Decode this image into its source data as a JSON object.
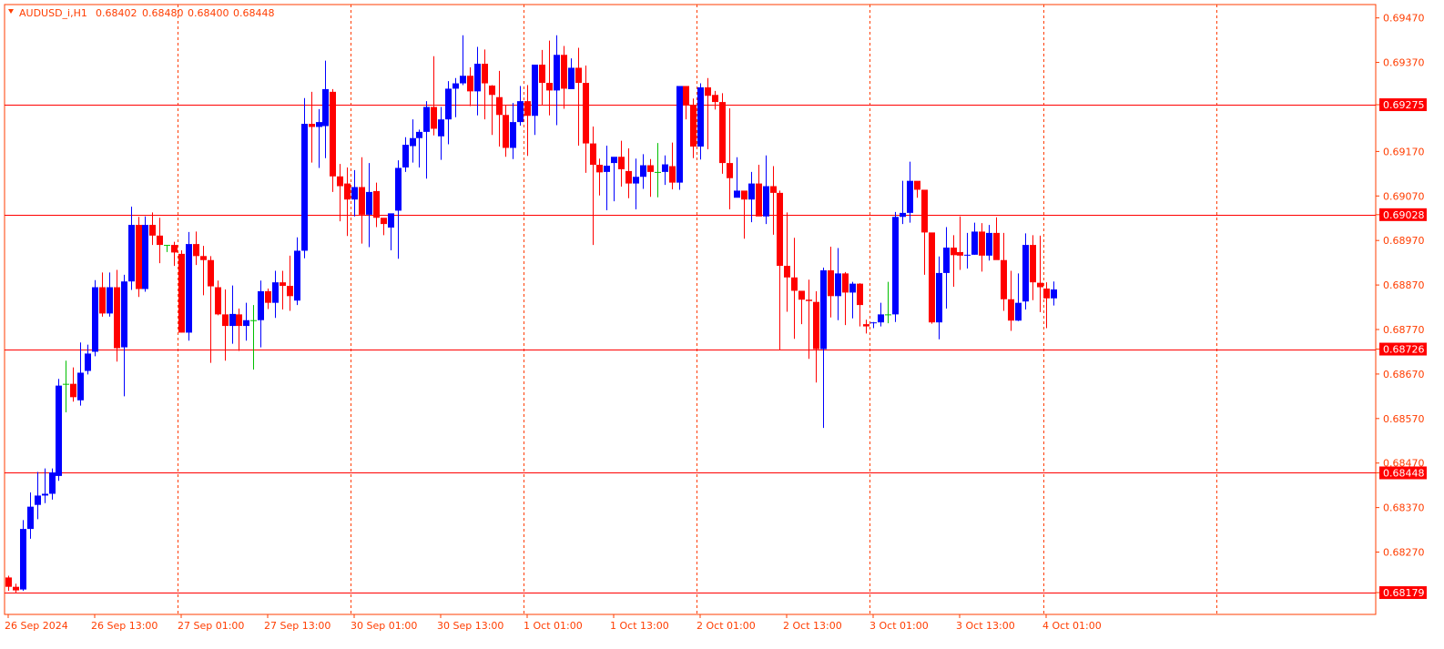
{
  "chart_data": {
    "type": "candlestick",
    "symbol_line": {
      "symbol": "AUDUSD_i,H1",
      "open": "0.68402",
      "high": "0.68480",
      "low": "0.68400",
      "close": "0.68448"
    },
    "y_range": [
      0.6813,
      0.695
    ],
    "price_ticks": [
      "0.69470",
      "0.69370",
      "0.69275",
      "0.69170",
      "0.69070",
      "0.69028",
      "0.68970",
      "0.68870",
      "0.68770",
      "0.68726",
      "0.68670",
      "0.68570",
      "0.68470",
      "0.68448",
      "0.68370",
      "0.68270",
      "0.68179"
    ],
    "levels": [
      0.69275,
      0.69028,
      0.68726,
      0.68448,
      0.68179
    ],
    "level_labels": [
      "0.69275",
      "0.69028",
      "0.68726",
      "0.68448",
      "0.68179"
    ],
    "time_labels": [
      "26 Sep 2024",
      "26 Sep 13:00",
      "27 Sep 01:00",
      "27 Sep 13:00",
      "30 Sep 01:00",
      "30 Sep 13:00",
      "1 Oct 01:00",
      "1 Oct 13:00",
      "2 Oct 01:00",
      "2 Oct 13:00",
      "3 Oct 01:00",
      "3 Oct 13:00",
      "4 Oct 01:00"
    ],
    "time_label_bars": [
      0,
      12,
      24,
      36,
      48,
      60,
      72,
      84,
      96,
      108,
      120,
      132,
      144
    ],
    "separator_bars": [
      23,
      47,
      71,
      95,
      119,
      143,
      167
    ],
    "total_bars": 190,
    "colors": {
      "up": "#0000ff",
      "down": "#ff0000",
      "axis": "#ff3d00",
      "level": "#ff0000",
      "separator": "#ff3d00",
      "doji": "#00c000"
    },
    "candles": [
      [
        0.68213,
        0.68217,
        0.68183,
        0.68192
      ],
      [
        0.68192,
        0.68199,
        0.68178,
        0.68184
      ],
      [
        0.68186,
        0.68342,
        0.68183,
        0.68322
      ],
      [
        0.68322,
        0.68404,
        0.683,
        0.68372
      ],
      [
        0.68376,
        0.6845,
        0.68344,
        0.68397
      ],
      [
        0.68397,
        0.68458,
        0.6838,
        0.68401
      ],
      [
        0.68401,
        0.68458,
        0.68388,
        0.68449
      ],
      [
        0.68441,
        0.68659,
        0.6843,
        0.68644
      ],
      [
        0.68648,
        0.687,
        0.68584,
        0.68648
      ],
      [
        0.68648,
        0.68685,
        0.68608,
        0.68618
      ],
      [
        0.68611,
        0.68741,
        0.68599,
        0.68673
      ],
      [
        0.68677,
        0.68736,
        0.68669,
        0.68716
      ],
      [
        0.6872,
        0.68881,
        0.6871,
        0.68865
      ],
      [
        0.68865,
        0.68898,
        0.68799,
        0.68806
      ],
      [
        0.68806,
        0.68898,
        0.68799,
        0.68865
      ],
      [
        0.68865,
        0.68904,
        0.68698,
        0.68728
      ],
      [
        0.6873,
        0.68893,
        0.6862,
        0.68878
      ],
      [
        0.68878,
        0.69046,
        0.68859,
        0.69005
      ],
      [
        0.69005,
        0.69023,
        0.68843,
        0.68861
      ],
      [
        0.68861,
        0.69024,
        0.68855,
        0.69005
      ],
      [
        0.69005,
        0.69033,
        0.6896,
        0.68981
      ],
      [
        0.68981,
        0.69021,
        0.68919,
        0.6896
      ],
      [
        0.6896,
        0.6896,
        0.68944,
        0.6896
      ],
      [
        0.6896,
        0.68967,
        0.68913,
        0.68943
      ],
      [
        0.6894,
        0.68948,
        0.68763,
        0.68763
      ],
      [
        0.68763,
        0.68989,
        0.68745,
        0.68962
      ],
      [
        0.68962,
        0.6899,
        0.68915,
        0.68935
      ],
      [
        0.68935,
        0.68958,
        0.68847,
        0.68926
      ],
      [
        0.68926,
        0.68935,
        0.68695,
        0.68867
      ],
      [
        0.68865,
        0.6888,
        0.68802,
        0.68804
      ],
      [
        0.68804,
        0.6886,
        0.687,
        0.68778
      ],
      [
        0.68778,
        0.68869,
        0.68738,
        0.68805
      ],
      [
        0.68804,
        0.68817,
        0.68722,
        0.68778
      ],
      [
        0.68778,
        0.6883,
        0.68745,
        0.68791
      ],
      [
        0.68791,
        0.68825,
        0.6868,
        0.68791
      ],
      [
        0.68791,
        0.6888,
        0.6873,
        0.68856
      ],
      [
        0.68856,
        0.68862,
        0.68816,
        0.6883
      ],
      [
        0.6883,
        0.68902,
        0.68796,
        0.68876
      ],
      [
        0.68876,
        0.68902,
        0.68815,
        0.68868
      ],
      [
        0.68868,
        0.68936,
        0.68812,
        0.68845
      ],
      [
        0.68835,
        0.68977,
        0.68825,
        0.68947
      ],
      [
        0.68947,
        0.6929,
        0.6893,
        0.69232
      ],
      [
        0.69232,
        0.69304,
        0.69145,
        0.69225
      ],
      [
        0.69225,
        0.69265,
        0.69133,
        0.69236
      ],
      [
        0.69227,
        0.69374,
        0.69155,
        0.6931
      ],
      [
        0.69304,
        0.6931,
        0.69079,
        0.69114
      ],
      [
        0.69114,
        0.69142,
        0.69013,
        0.69092
      ],
      [
        0.69098,
        0.69134,
        0.6898,
        0.69062
      ],
      [
        0.69062,
        0.69128,
        0.69024,
        0.6909
      ],
      [
        0.6909,
        0.69157,
        0.68963,
        0.69028
      ],
      [
        0.69028,
        0.69144,
        0.68955,
        0.69079
      ],
      [
        0.69081,
        0.691,
        0.69,
        0.69021
      ],
      [
        0.69021,
        0.69017,
        0.68982,
        0.69007
      ],
      [
        0.68999,
        0.6903,
        0.68948,
        0.69031
      ],
      [
        0.69037,
        0.6915,
        0.68929,
        0.69133
      ],
      [
        0.69134,
        0.69202,
        0.69124,
        0.69185
      ],
      [
        0.69182,
        0.69242,
        0.69145,
        0.692
      ],
      [
        0.692,
        0.69219,
        0.69134,
        0.69214
      ],
      [
        0.69214,
        0.69283,
        0.69109,
        0.6927
      ],
      [
        0.6927,
        0.69384,
        0.69206,
        0.69221
      ],
      [
        0.69204,
        0.6927,
        0.69151,
        0.69242
      ],
      [
        0.69242,
        0.69328,
        0.69186,
        0.69311
      ],
      [
        0.69311,
        0.69335,
        0.69247,
        0.69323
      ],
      [
        0.69323,
        0.69431,
        0.69319,
        0.6934
      ],
      [
        0.6934,
        0.69359,
        0.69272,
        0.69305
      ],
      [
        0.69305,
        0.69405,
        0.69251,
        0.69367
      ],
      [
        0.69367,
        0.69399,
        0.69242,
        0.69323
      ],
      [
        0.69318,
        0.69319,
        0.69207,
        0.69297
      ],
      [
        0.69292,
        0.69351,
        0.69181,
        0.69252
      ],
      [
        0.69252,
        0.69274,
        0.69158,
        0.69178
      ],
      [
        0.69178,
        0.69279,
        0.69153,
        0.69236
      ],
      [
        0.69236,
        0.69317,
        0.69228,
        0.69283
      ],
      [
        0.69283,
        0.69319,
        0.6916,
        0.6925
      ],
      [
        0.6925,
        0.69327,
        0.69207,
        0.69365
      ],
      [
        0.69365,
        0.69398,
        0.69275,
        0.69324
      ],
      [
        0.69324,
        0.69419,
        0.69251,
        0.69307
      ],
      [
        0.69307,
        0.69431,
        0.69229,
        0.69387
      ],
      [
        0.69387,
        0.69407,
        0.69266,
        0.69311
      ],
      [
        0.6931,
        0.69379,
        0.69327,
        0.69358
      ],
      [
        0.69358,
        0.69403,
        0.69183,
        0.69324
      ],
      [
        0.69324,
        0.69363,
        0.69122,
        0.69188
      ],
      [
        0.69188,
        0.69226,
        0.6896,
        0.6914
      ],
      [
        0.6914,
        0.69154,
        0.69071,
        0.69123
      ],
      [
        0.69124,
        0.69183,
        0.69038,
        0.69138
      ],
      [
        0.69144,
        0.69156,
        0.69058,
        0.69158
      ],
      [
        0.69158,
        0.69194,
        0.69091,
        0.6913
      ],
      [
        0.69126,
        0.69177,
        0.69065,
        0.69098
      ],
      [
        0.69098,
        0.69154,
        0.6904,
        0.69113
      ],
      [
        0.69113,
        0.69164,
        0.69086,
        0.69139
      ],
      [
        0.69139,
        0.69153,
        0.69068,
        0.69124
      ],
      [
        0.69124,
        0.69189,
        0.69067,
        0.69124
      ],
      [
        0.69124,
        0.69161,
        0.69095,
        0.69141
      ],
      [
        0.69137,
        0.6919,
        0.69085,
        0.691
      ],
      [
        0.691,
        0.69289,
        0.69084,
        0.69317
      ],
      [
        0.69317,
        0.69304,
        0.69242,
        0.69274
      ],
      [
        0.69274,
        0.69289,
        0.69155,
        0.69181
      ],
      [
        0.69181,
        0.69323,
        0.69152,
        0.69314
      ],
      [
        0.69314,
        0.69335,
        0.69175,
        0.69295
      ],
      [
        0.69297,
        0.69306,
        0.69264,
        0.69281
      ],
      [
        0.69281,
        0.69301,
        0.6912,
        0.69144
      ],
      [
        0.69144,
        0.69267,
        0.6904,
        0.6911
      ],
      [
        0.69066,
        0.69157,
        0.69071,
        0.69082
      ],
      [
        0.69082,
        0.69076,
        0.68974,
        0.69062
      ],
      [
        0.69062,
        0.69124,
        0.69011,
        0.69098
      ],
      [
        0.69098,
        0.6914,
        0.69036,
        0.69024
      ],
      [
        0.69024,
        0.69161,
        0.69007,
        0.69092
      ],
      [
        0.69092,
        0.69137,
        0.68983,
        0.69077
      ],
      [
        0.69077,
        0.69082,
        0.68724,
        0.68913
      ],
      [
        0.68913,
        0.69033,
        0.6881,
        0.68887
      ],
      [
        0.68887,
        0.68976,
        0.68749,
        0.68857
      ],
      [
        0.68857,
        0.6885,
        0.68782,
        0.68837
      ],
      [
        0.68837,
        0.68882,
        0.68704,
        0.68834
      ],
      [
        0.68832,
        0.68856,
        0.68651,
        0.68726
      ],
      [
        0.68726,
        0.68909,
        0.68549,
        0.68903
      ],
      [
        0.68903,
        0.68956,
        0.68797,
        0.68845
      ],
      [
        0.68845,
        0.68953,
        0.68791,
        0.68896
      ],
      [
        0.68896,
        0.68899,
        0.6878,
        0.68853
      ],
      [
        0.68853,
        0.68877,
        0.68795,
        0.68873
      ],
      [
        0.68873,
        0.68874,
        0.68777,
        0.68825
      ],
      [
        0.68782,
        0.68792,
        0.68761,
        0.68777
      ],
      [
        0.68785,
        0.68787,
        0.68773,
        0.68786
      ],
      [
        0.68786,
        0.6883,
        0.68777,
        0.68804
      ],
      [
        0.68804,
        0.68877,
        0.68784,
        0.68804
      ],
      [
        0.68804,
        0.69034,
        0.68787,
        0.69023
      ],
      [
        0.69023,
        0.69104,
        0.69007,
        0.69032
      ],
      [
        0.69032,
        0.69147,
        0.6901,
        0.69104
      ],
      [
        0.69104,
        0.69102,
        0.69066,
        0.69084
      ],
      [
        0.69084,
        0.69076,
        0.68893,
        0.68988
      ],
      [
        0.68988,
        0.68986,
        0.68783,
        0.68786
      ],
      [
        0.68786,
        0.68934,
        0.68748,
        0.68897
      ],
      [
        0.68897,
        0.69,
        0.68817,
        0.68954
      ],
      [
        0.68954,
        0.68982,
        0.68866,
        0.68937
      ],
      [
        0.68944,
        0.69024,
        0.68904,
        0.68936
      ],
      [
        0.68936,
        0.68987,
        0.68907,
        0.68938
      ],
      [
        0.68938,
        0.6901,
        0.68938,
        0.6899
      ],
      [
        0.6899,
        0.69009,
        0.689,
        0.68936
      ],
      [
        0.68936,
        0.69005,
        0.68925,
        0.68987
      ],
      [
        0.68987,
        0.69022,
        0.68932,
        0.68926
      ],
      [
        0.68926,
        0.68987,
        0.68812,
        0.68838
      ],
      [
        0.68838,
        0.68902,
        0.68767,
        0.6879
      ],
      [
        0.6879,
        0.68896,
        0.68789,
        0.6883
      ],
      [
        0.68833,
        0.68986,
        0.68815,
        0.6896
      ],
      [
        0.6896,
        0.68982,
        0.68836,
        0.68876
      ],
      [
        0.68875,
        0.68981,
        0.68809,
        0.68865
      ],
      [
        0.68862,
        0.68876,
        0.68773,
        0.6884
      ],
      [
        0.6884,
        0.68878,
        0.68824,
        0.6886
      ]
    ]
  }
}
